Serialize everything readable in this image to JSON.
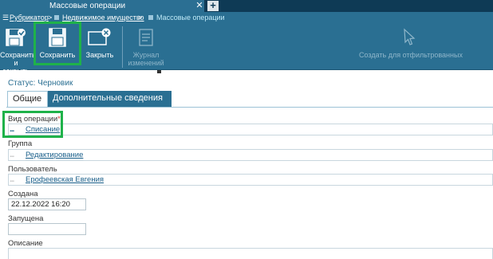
{
  "tab": {
    "title": "Массовые операции",
    "close_glyph": "✕",
    "add_glyph": "+"
  },
  "breadcrumb": {
    "menu_glyph": "☰",
    "items": [
      "Рубрикатор",
      "Недвижимое имущество"
    ],
    "separator": ">",
    "current": "Массовые операции"
  },
  "toolbar": {
    "save_close_label": "Сохранить и закрыть",
    "save_label": "Сохранить",
    "close_label": "Закрыть",
    "journal_label": "Журнал изменений",
    "create_filtered_label": "Создать для отфильтрованных"
  },
  "status": "Статус: Черновик",
  "tabs": [
    "Общие",
    "Дополнительные сведения"
  ],
  "fields": {
    "operation_type": {
      "label": "Вид операции",
      "required_mark": "*",
      "value": "Списание"
    },
    "group": {
      "label": "Группа",
      "value": "Редактирование"
    },
    "user": {
      "label": "Пользователь",
      "value": "Ерофеевская Евгения"
    },
    "created": {
      "label": "Создана",
      "value": "22.12.2022 16:20"
    },
    "started": {
      "label": "Запущена",
      "value": ""
    },
    "description": {
      "label": "Описание",
      "value": ""
    }
  },
  "colors": {
    "accent": "#2a6f92",
    "dark": "#0e3a55",
    "highlight": "#1fb24a",
    "link": "#1a5f8a",
    "required": "#d43b2a"
  }
}
